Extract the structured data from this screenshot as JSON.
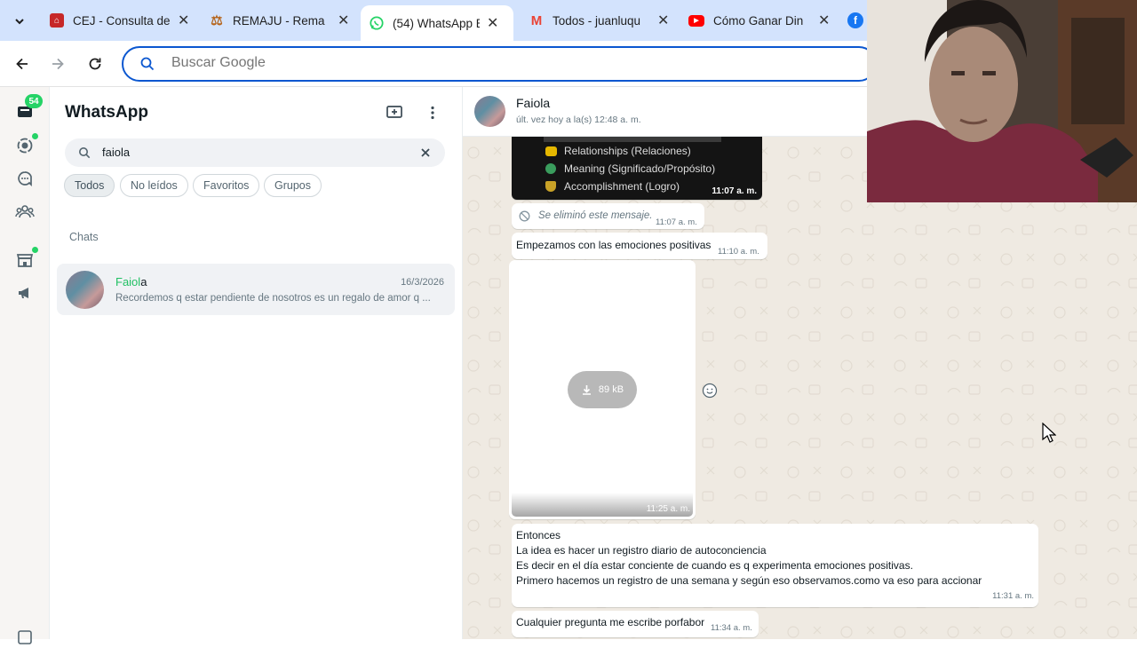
{
  "browser": {
    "tabs": [
      {
        "title": "CEJ - Consulta de",
        "icon": "cej-icon",
        "color": "#c62828"
      },
      {
        "title": "REMAJU - Rema",
        "icon": "remaju-icon",
        "color": "#b5651d"
      },
      {
        "title": "(54) WhatsApp B",
        "icon": "whatsapp-icon",
        "color": "#25d366"
      },
      {
        "title": "Todos - juanluqu",
        "icon": "gmail-icon",
        "color": "#ea4335"
      },
      {
        "title": "Cómo Ganar Din",
        "icon": "youtube-icon",
        "color": "#ff0000"
      }
    ],
    "omnibox_placeholder": "Buscar Google"
  },
  "whatsapp": {
    "rail": {
      "badge": "54"
    },
    "title": "WhatsApp",
    "search_value": "faiola",
    "filters": [
      "Todos",
      "No leídos",
      "Favoritos",
      "Grupos"
    ],
    "chats_label": "Chats",
    "chat": {
      "name_match": "Faiol",
      "name_rest": "a",
      "date": "16/3/2026",
      "preview": "Recordemos q estar pendiente de nosotros es un regalo de amor q ..."
    },
    "conversation": {
      "name": "Faiola",
      "status": "últ. vez hoy a la(s) 12:48 a. m.",
      "image1": {
        "lines": [
          "Relationships (Relaciones)",
          "Meaning (Significado/Propósito)",
          "Accomplishment (Logro)"
        ],
        "time": "11:07 a. m."
      },
      "deleted": {
        "text": "Se eliminó este mensaje.",
        "time": "11:07 a. m."
      },
      "msg1": {
        "text": "Empezamos con las emociones positivas",
        "time": "11:10 a. m."
      },
      "image2": {
        "size": "89 kB",
        "time": "11:25 a. m."
      },
      "msg2": {
        "lines": [
          "Entonces",
          "La idea es hacer un registro diario de autoconciencia",
          "Es decir en el día estar conciente de cuando es q experimenta emociones positivas.",
          "Primero hacemos un registro de una semana y según eso observamos.como va eso para accionar"
        ],
        "time": "11:31 a. m."
      },
      "msg3": {
        "text": "Cualquier pregunta me escribe porfabor",
        "time": "11:34 a. m."
      }
    }
  }
}
